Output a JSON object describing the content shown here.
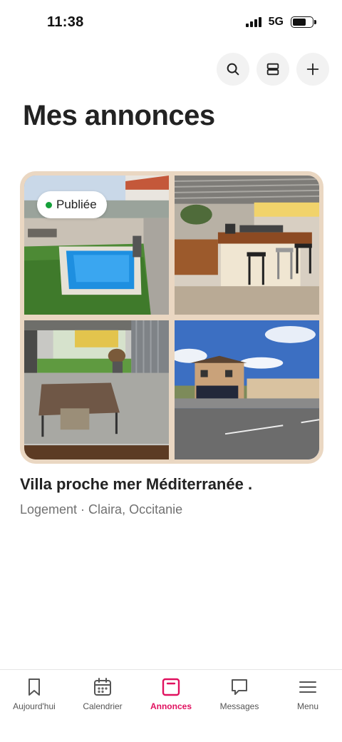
{
  "status_bar": {
    "time": "11:38",
    "network": "5G",
    "battery_level": 0.7
  },
  "header": {
    "title": "Mes annonces"
  },
  "top_actions": [
    {
      "icon": "search-icon"
    },
    {
      "icon": "layout-icon"
    },
    {
      "icon": "plus-icon"
    }
  ],
  "listing": {
    "status": "Publiée",
    "status_color": "#15a03a",
    "title": "Villa proche mer Méditerranée .",
    "subtitle": "Logement · Claira, Occitanie",
    "photos": [
      "pool-photo",
      "outdoor-kitchen-photo",
      "patio-table-photo",
      "house-street-photo"
    ]
  },
  "bottom_nav": {
    "accent": "#e0115f",
    "items": [
      {
        "label": "Aujourd'hui",
        "icon": "bookmark-icon",
        "active": false
      },
      {
        "label": "Calendrier",
        "icon": "calendar-icon",
        "active": false
      },
      {
        "label": "Annonces",
        "icon": "listing-icon",
        "active": true
      },
      {
        "label": "Messages",
        "icon": "message-icon",
        "active": false
      },
      {
        "label": "Menu",
        "icon": "menu-icon",
        "active": false
      }
    ]
  }
}
